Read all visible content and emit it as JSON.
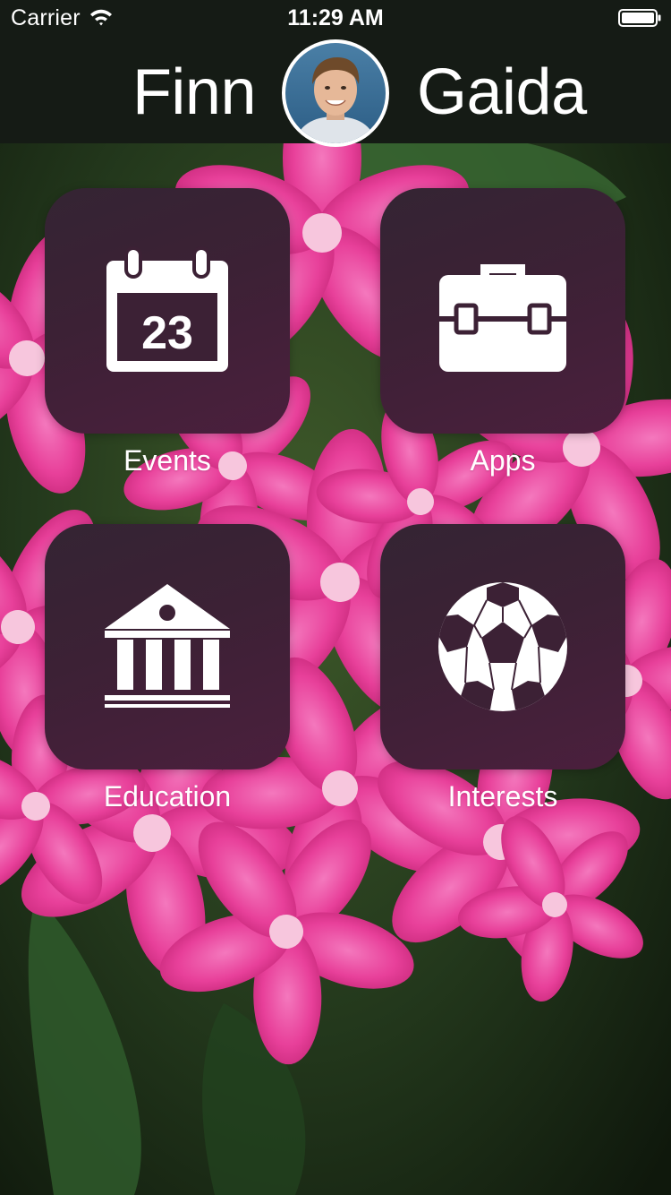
{
  "status_bar": {
    "carrier": "Carrier",
    "time": "11:29 AM",
    "wifi_icon": "wifi-icon",
    "battery_icon": "battery-full-icon"
  },
  "header": {
    "first_name": "Finn",
    "last_name": "Gaida",
    "avatar_icon": "profile-photo",
    "background_color": "#151b15"
  },
  "tiles": [
    {
      "label": "Events",
      "icon": "calendar-icon",
      "icon_text": "23"
    },
    {
      "label": "Apps",
      "icon": "briefcase-icon"
    },
    {
      "label": "Education",
      "icon": "institution-icon"
    },
    {
      "label": "Interests",
      "icon": "soccer-ball-icon"
    }
  ],
  "colors": {
    "tile_background": "#3c2135",
    "text": "#ffffff",
    "flower_pink": "#e9429a",
    "leaf_green": "#22401c"
  }
}
